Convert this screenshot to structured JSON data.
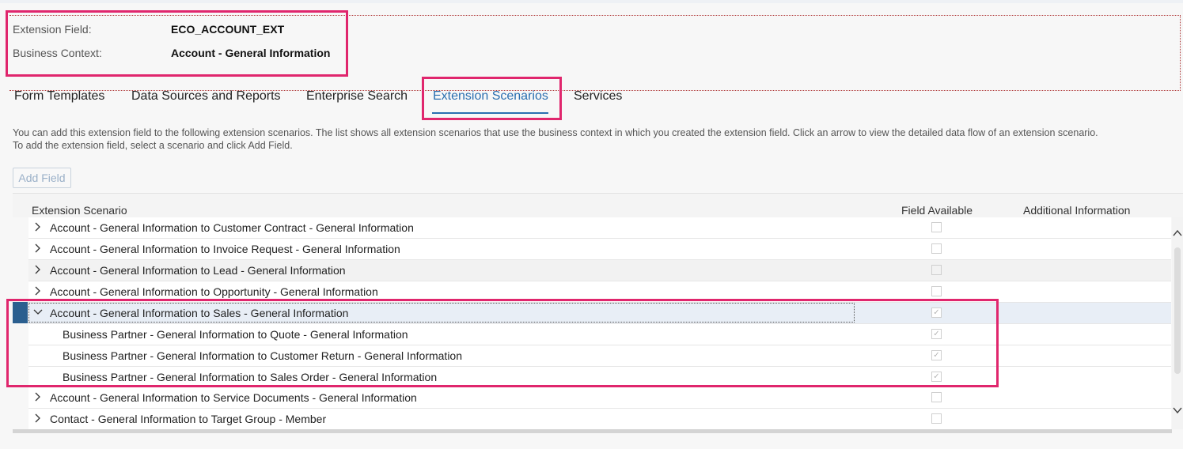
{
  "header": {
    "extension_field_label": "Extension Field:",
    "extension_field_value": "ECO_ACCOUNT_EXT",
    "business_context_label": "Business Context:",
    "business_context_value": "Account - General Information"
  },
  "tabs": [
    {
      "label": "Form Templates",
      "active": false
    },
    {
      "label": "Data Sources and Reports",
      "active": false
    },
    {
      "label": "Enterprise Search",
      "active": false
    },
    {
      "label": "Extension Scenarios",
      "active": true
    },
    {
      "label": "Services",
      "active": false
    }
  ],
  "description": {
    "line1": "You can add this extension field to the following extension scenarios. The list shows all extension scenarios that use the business context in which you created the extension field. Click an arrow to view the detailed data flow of an extension scenario.",
    "line2": "To add the extension field, select a scenario and click Add Field."
  },
  "toolbar": {
    "add_field_label": "Add Field"
  },
  "table": {
    "columns": [
      "Extension Scenario",
      "Field Available",
      "Additional Information"
    ],
    "rows": [
      {
        "label": "Account - General Information to Customer Contract - General Information",
        "expanded": false,
        "level": 0,
        "checked": false
      },
      {
        "label": "Account - General Information to Invoice Request - General Information",
        "expanded": false,
        "level": 0,
        "checked": false
      },
      {
        "label": "Account - General Information to Lead - General Information",
        "expanded": false,
        "level": 0,
        "checked": false
      },
      {
        "label": "Account - General Information to Opportunity - General Information",
        "expanded": false,
        "level": 0,
        "checked": false
      },
      {
        "label": "Account - General Information to Sales - General Information",
        "expanded": true,
        "level": 0,
        "checked": true,
        "selected": true
      },
      {
        "label": "Business Partner - General Information to Quote - General Information",
        "level": 1,
        "checked": true
      },
      {
        "label": "Business Partner - General Information to Customer Return - General Information",
        "level": 1,
        "checked": true
      },
      {
        "label": "Business Partner - General Information to Sales Order - General Information",
        "level": 1,
        "checked": true
      },
      {
        "label": "Account - General Information to Service Documents - General Information",
        "expanded": false,
        "level": 0,
        "checked": false
      },
      {
        "label": "Contact - General Information to Target Group - Member",
        "expanded": false,
        "level": 0,
        "checked": false
      }
    ]
  },
  "colors": {
    "highlight": "#e0266d",
    "accent": "#2a6fb0",
    "selection_marker": "#2b5f8f"
  },
  "icons": {
    "collapsed": "chevron-right-icon",
    "expanded": "chevron-down-icon",
    "check": "checkmark-icon",
    "scroll_up": "scroll-up-icon",
    "scroll_down": "scroll-down-icon"
  }
}
